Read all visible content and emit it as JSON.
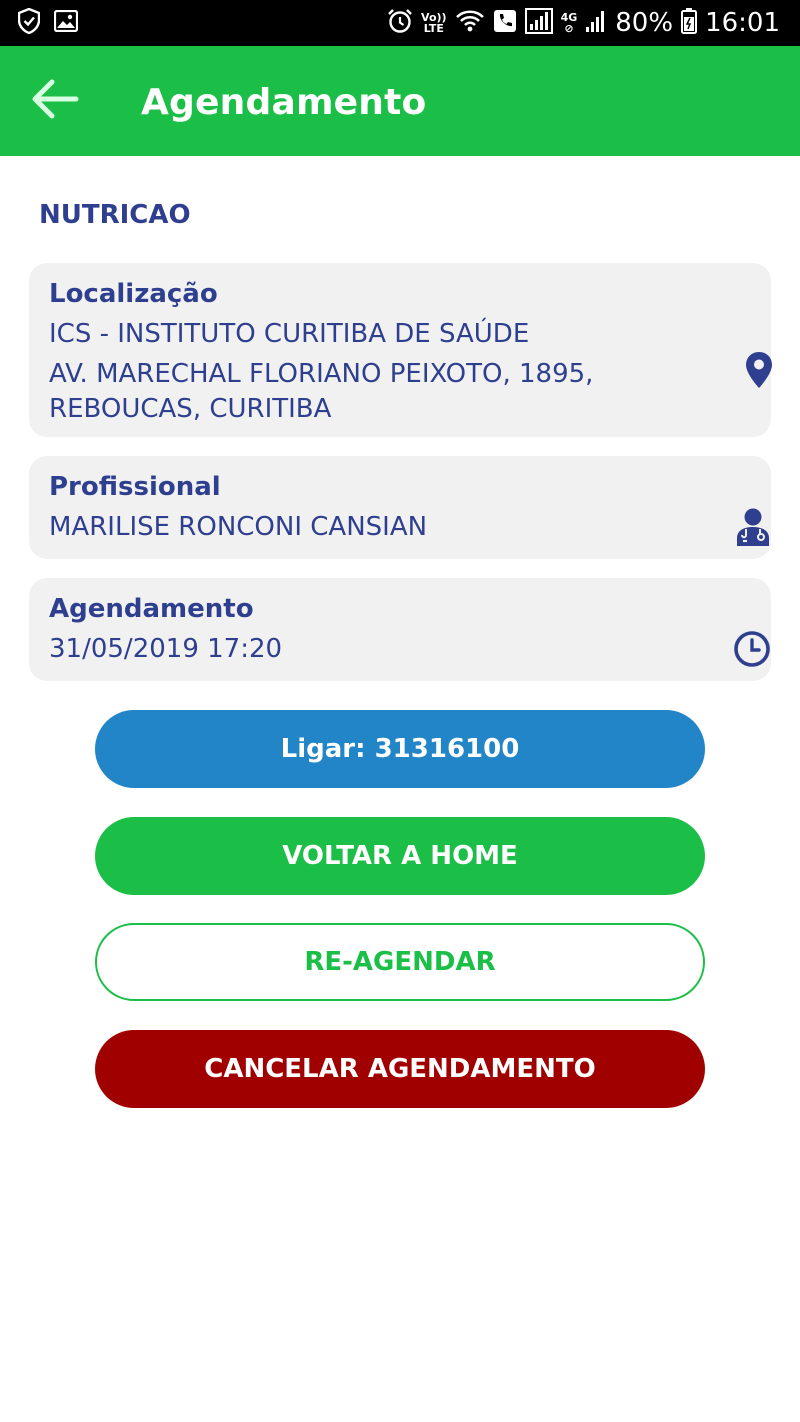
{
  "status_bar": {
    "volte_top": "Vo))",
    "volte_bottom": "LTE",
    "network_small": "4G",
    "battery": "80%",
    "time": "16:01"
  },
  "app_bar": {
    "title": "Agendamento",
    "back_icon": "arrow-left-icon"
  },
  "specialty": "NUTRICAO",
  "location": {
    "label": "Localização",
    "name": "ICS - INSTITUTO CURITIBA DE SAÚDE",
    "address": "AV. MARECHAL FLORIANO PEIXOTO, 1895, REBOUCAS, CURITIBA",
    "icon": "map-pin-icon"
  },
  "professional": {
    "label": "Profissional",
    "name": "MARILISE RONCONI CANSIAN",
    "icon": "doctor-icon"
  },
  "appointment": {
    "label": "Agendamento",
    "datetime": "31/05/2019 17:20",
    "icon": "clock-icon"
  },
  "buttons": {
    "call": "Ligar: 31316100",
    "home": "VOLTAR A HOME",
    "reschedule": "RE-AGENDAR",
    "cancel": "CANCELAR AGENDAMENTO"
  },
  "colors": {
    "primary_green": "#1bbf47",
    "text_navy": "#2f3f8f",
    "call_blue": "#2185c8",
    "cancel_red": "#a00000",
    "card_gray": "#f1f1f1"
  }
}
